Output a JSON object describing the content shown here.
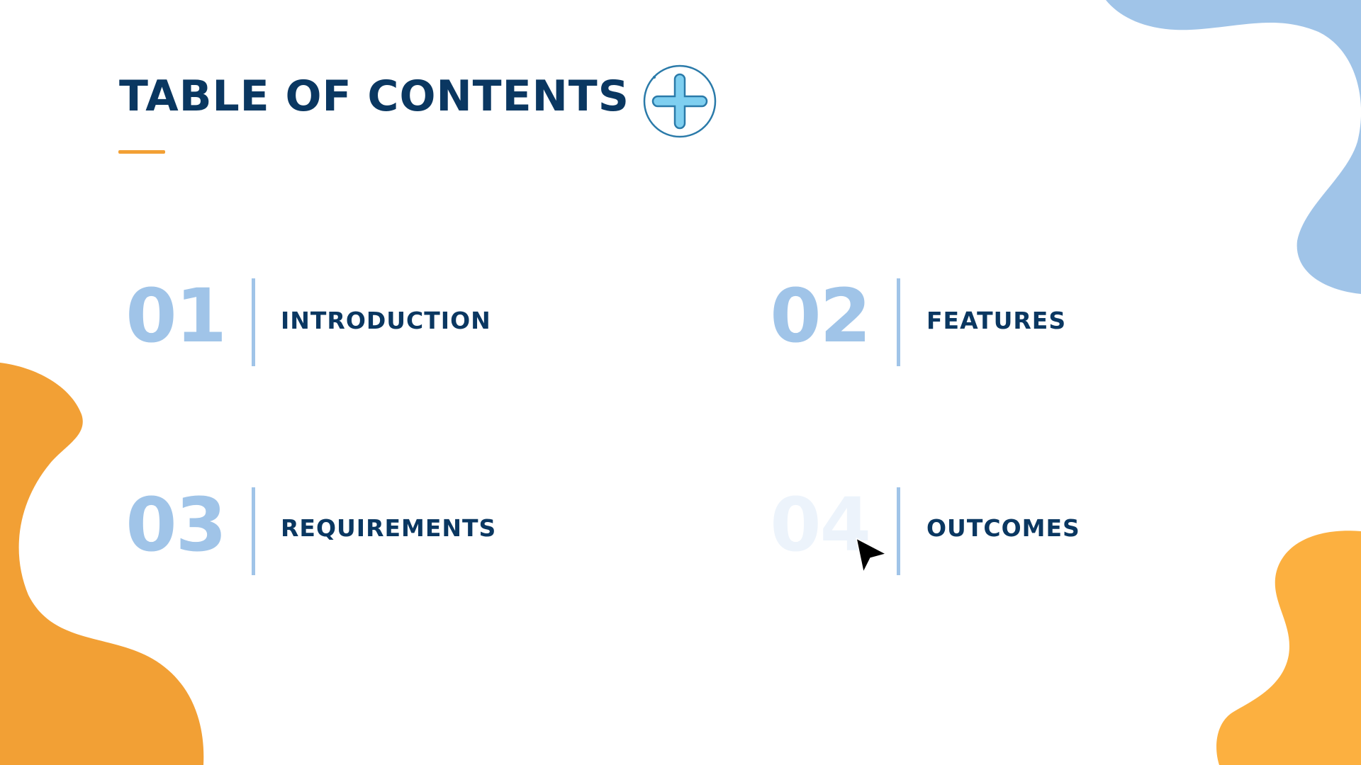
{
  "slide": {
    "title": "TABLE OF CONTENTS",
    "title_icon": "medical-cross-icon",
    "items": [
      {
        "number": "01",
        "label": "INTRODUCTION"
      },
      {
        "number": "02",
        "label": "FEATURES"
      },
      {
        "number": "03",
        "label": "REQUIREMENTS"
      },
      {
        "number": "04",
        "label": "OUTCOMES"
      }
    ]
  },
  "colors": {
    "title": "#0a3761",
    "accent_orange": "#f2a035",
    "number_blue": "#a0c4e8",
    "number_faded": "#ecf3fb",
    "divider_blue": "#a0c4e8",
    "blob_blue": "#a0c4e8",
    "blob_orange_left": "#f2a035",
    "blob_orange_right": "#fcb040",
    "icon_outline": "#2a7aa9",
    "icon_fill": "#7fcff0",
    "cursor": "#000000"
  },
  "cursor": {
    "icon": "mouse-pointer-icon"
  }
}
